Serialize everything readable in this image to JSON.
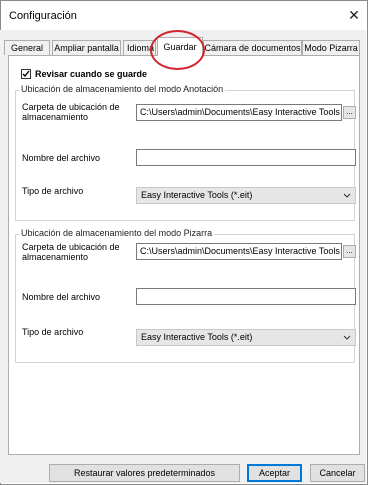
{
  "window": {
    "title": "Configuración"
  },
  "tabs": [
    {
      "label": "General"
    },
    {
      "label": "Ampliar pantalla"
    },
    {
      "label": "Idioma"
    },
    {
      "label": "Guardar",
      "active": true
    },
    {
      "label": "Cámara de documentos"
    },
    {
      "label": "Modo Pizarra"
    }
  ],
  "options": {
    "check_on_save": {
      "label": "Revisar cuando se guarde",
      "checked": true
    }
  },
  "annotation_group": {
    "title": "Ubicación de almacenamiento del modo Anotación",
    "folder_label": "Carpeta de ubicación de almacenamiento",
    "folder_value": "C:\\Users\\admin\\Documents\\Easy Interactive Tools",
    "browse_label": "...",
    "filename_label": "Nombre del archivo",
    "filename_value": "",
    "filetype_label": "Tipo de archivo",
    "filetype_value": "Easy Interactive Tools (*.eit)"
  },
  "whiteboard_group": {
    "title": "Ubicación de almacenamiento del modo Pizarra",
    "folder_label": "Carpeta de ubicación de almacenamiento",
    "folder_value": "C:\\Users\\admin\\Documents\\Easy Interactive Tools",
    "browse_label": "...",
    "filename_label": "Nombre del archivo",
    "filename_value": "",
    "filetype_label": "Tipo de archivo",
    "filetype_value": "Easy Interactive Tools (*.eit)"
  },
  "footer": {
    "restore_label": "Restaurar valores predeterminados",
    "ok_label": "Aceptar",
    "cancel_label": "Cancelar"
  },
  "icons": {
    "close": "close-icon",
    "chevron": "chevron-down-icon",
    "check": "checkmark-icon"
  },
  "colors": {
    "highlight_ring": "#d0262e",
    "primary_button_border": "#0078d7"
  }
}
